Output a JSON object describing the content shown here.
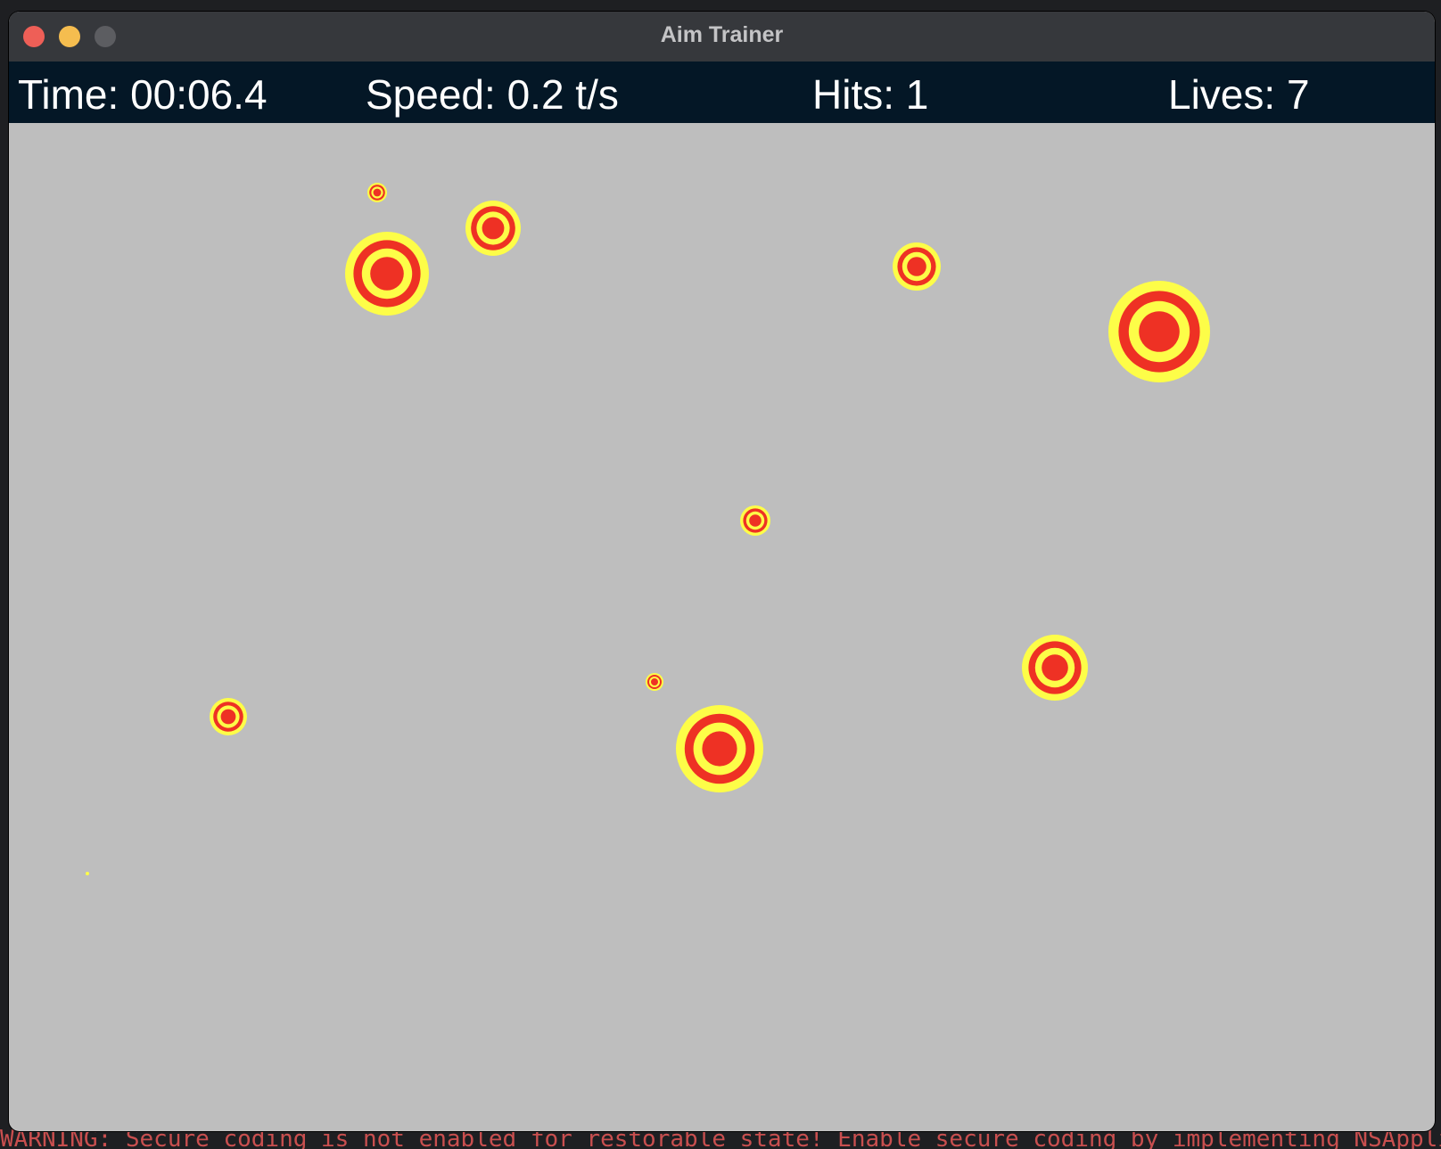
{
  "window": {
    "title": "Aim Trainer"
  },
  "hud": {
    "time": "Time: 00:06.4",
    "speed": "Speed: 0.2 t/s",
    "hits": "Hits: 1",
    "lives": "Lives: 7"
  },
  "colors": {
    "playfield": "#bebebe",
    "hud_bg": "#041726",
    "target_red": "#ee3124",
    "target_yellow": "#fdfd48"
  },
  "background_terminal": {
    "footer_text": "WARNING: Secure coding is not enabled for restorable state! Enable secure coding by implementing NSApplicationDelegate"
  }
}
